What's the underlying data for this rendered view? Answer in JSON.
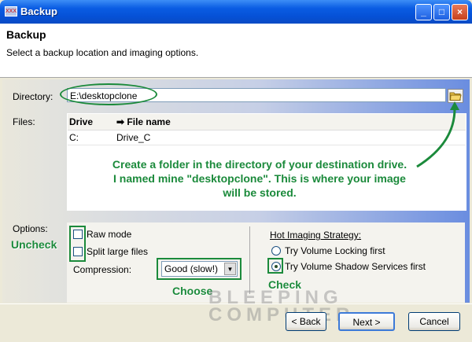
{
  "window": {
    "title": "Backup",
    "app_icon_label": "XXX",
    "controls": {
      "minimize": "_",
      "maximize": "□",
      "close": "×"
    }
  },
  "header": {
    "title": "Backup",
    "subtitle": "Select a backup location and imaging options."
  },
  "directory": {
    "label": "Directory:",
    "value": "E:\\desktopclone",
    "browse_icon": "folder-icon"
  },
  "files": {
    "label": "Files:",
    "columns": [
      "Drive",
      "File name"
    ],
    "sort_indicator": "➡",
    "rows": [
      {
        "drive": "C:",
        "file_name": "Drive_C"
      }
    ]
  },
  "note": {
    "line1": "Create a folder in the directory of your destination drive.",
    "line2": "I named mine \"desktopclone\".  This is where your image",
    "line3": "will be stored."
  },
  "options": {
    "label": "Options:",
    "raw_mode": {
      "label": "Raw mode",
      "checked": false
    },
    "split_large_files": {
      "label": "Split large files",
      "checked": false
    },
    "compression": {
      "label": "Compression:",
      "value": "Good (slow!)"
    },
    "hot_imaging": {
      "title": "Hot Imaging Strategy:",
      "choices": [
        {
          "label": "Try Volume Locking first",
          "selected": false
        },
        {
          "label": "Try Volume Shadow Services first",
          "selected": true
        }
      ]
    }
  },
  "annotations": {
    "uncheck": "Uncheck",
    "choose": "Choose",
    "check": "Check"
  },
  "watermark": {
    "line1": "BLEEPING",
    "line2": "COMPUTER"
  },
  "footer": {
    "back": "< Back",
    "next": "Next >",
    "cancel": "Cancel"
  },
  "colors": {
    "annotation": "#1b8a3b",
    "title_bar": "#0a5ce3"
  }
}
